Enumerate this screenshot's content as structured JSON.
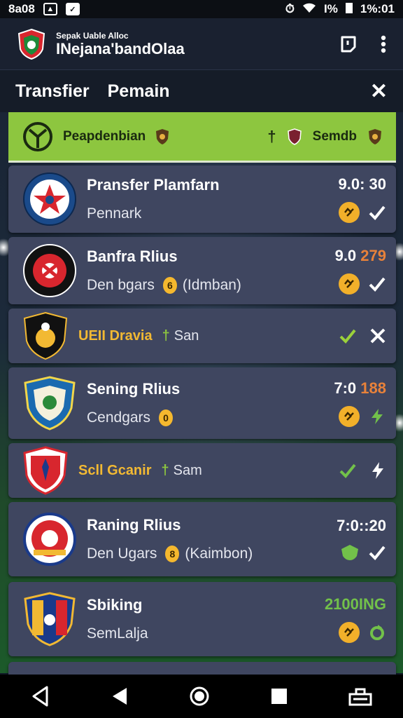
{
  "status_bar": {
    "time_left": "8a08",
    "battery": "I%",
    "time_right": "1%:01"
  },
  "app_bar": {
    "subtitle": "Sepak Uable Alloc",
    "title": "INejana'bandOlaa"
  },
  "header": {
    "title_a": "Transfier",
    "title_b": "Pemain"
  },
  "filter": {
    "label": "Peapdenbian",
    "right_label": "Semdb"
  },
  "rows": [
    {
      "name": "Pransfer Plamfarn",
      "sub": "Pennark",
      "time": "9.0: 30"
    },
    {
      "name": "Banfra Rlius",
      "sub": "Den bgars",
      "coin": "6",
      "sub_extra": "(Idmban)",
      "time_a": "9.0 ",
      "time_b": "279"
    },
    {
      "gold": "UEII Dravia",
      "arrow": "†",
      "rest": "San"
    },
    {
      "name": "Sening Rlius",
      "sub": "Cendgars",
      "coin": "0",
      "time_a": "7:0 ",
      "time_b": "188"
    },
    {
      "gold": "Scll Gcanir",
      "arrow": "†",
      "rest": "Sam"
    },
    {
      "name": "Raning Rlius",
      "sub": "Den Ugars",
      "coin": "8",
      "sub_extra": "(Kaimbon)",
      "time": "7:0::20"
    },
    {
      "name": "Sbiking",
      "sub": "SemLalja",
      "time": "2100ING"
    }
  ],
  "colors": {
    "accent_green": "#8dc63f",
    "card_bg": "#3f4660",
    "coin_gold": "#f2b02a",
    "highlight_orange": "#e8823a"
  },
  "icons": [
    "logo-shield-icon",
    "note-icon",
    "more-vert-icon",
    "close-icon",
    "soccer-ball-icon",
    "check-icon",
    "bolt-icon",
    "back-icon",
    "home-icon",
    "recents-icon"
  ]
}
